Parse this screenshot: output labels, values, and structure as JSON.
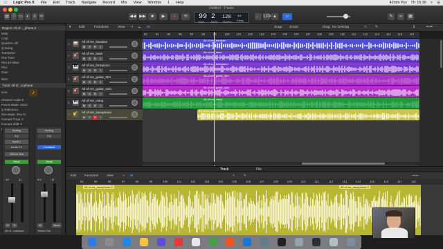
{
  "menubar": {
    "apple": "",
    "app": "Logic Pro X",
    "items": [
      "File",
      "Edit",
      "Track",
      "Navigate",
      "Record",
      "Mix",
      "View",
      "Window",
      "1",
      "Help"
    ],
    "status": "42min Рус",
    "clock": "Пт 15:36"
  },
  "window": {
    "title": "Untitled - Tracks"
  },
  "lcd": {
    "bar": "99",
    "beat": "2",
    "bar_label": "BAR",
    "beat_label": "BEAT",
    "tempo": "120",
    "tempo_label": "TEMPO",
    "signature": "4/4",
    "key": "Cmaj"
  },
  "inspector": {
    "region_header": "Region: All of..._phone.2",
    "region_params": [
      "Mute:",
      "Loop:",
      "Quantize: off",
      "Q-Swing:",
      "Transpose:",
      "Fine Tune:",
      "Flex & Follow:",
      "Flex:",
      "Gain:"
    ],
    "more": "More",
    "track_header": "Track: All of...xophone",
    "track_params": [
      "Icon:",
      "Channel: Audio 6",
      "Freeze Mode: Sourc",
      "Q-Reference:",
      "Flex Mode: Flex Pi",
      "Formant Track: 0",
      "Formant Shift: 0",
      "Formants: Proce"
    ],
    "strip1_label": "All of...xophone",
    "strip2_label": "Stereo Out",
    "strip1_buttons": [
      "Setting",
      "EQ",
      "Input 1",
      "Audio FX",
      "Stereo Out",
      "Read"
    ],
    "strip2_buttons": [
      "Setting",
      "EQ",
      "Constant",
      "Read"
    ],
    "strip1_value": "-10",
    "strip1_value2": "-11",
    "strip2_value": "0.0",
    "strip2_value2": "-17",
    "bnce_label": "Bnce"
  },
  "tracks_toolbar": {
    "edit": "Edit",
    "functions": "Functions",
    "view": "View",
    "snap_label": "Snap:",
    "snap_value": "Smart",
    "drag_label": "Drag:",
    "drag_value": "No Overlap"
  },
  "ruler": [
    "93",
    "94",
    "95",
    "96",
    "97",
    "98",
    "99",
    "100",
    "101",
    "102",
    "103",
    "104",
    "105",
    "106",
    "107",
    "108",
    "109",
    "110",
    "111",
    "112",
    "113",
    "114",
    "115",
    "116"
  ],
  "tracks": [
    {
      "num": "1",
      "name": "All of me_baraban",
      "icon": "🥁"
    },
    {
      "num": "2",
      "name": "All of me_bass",
      "icon": "🎸"
    },
    {
      "num": "3",
      "name": "All of me_fortepiano",
      "icon": "🎹"
    },
    {
      "num": "4",
      "name": "All of me_guitar_ritm",
      "icon": "🎸"
    },
    {
      "num": "5",
      "name": "All of me_guitar_solo",
      "icon": "🎸"
    },
    {
      "num": "6",
      "name": "All of me_vstup",
      "icon": "🎹"
    },
    {
      "num": "7",
      "name": "All of me_saxophone",
      "icon": "🎷"
    }
  ],
  "track_buttons": {
    "mute": "M",
    "solo": "S",
    "rec": "R",
    "input": "I"
  },
  "regions": [
    {
      "label": "All of me_baraban",
      "color": "#4f4fd6"
    },
    {
      "label": "All of me_bass",
      "color": "#6b3fc6"
    },
    {
      "label": "All of me_fortepiano",
      "color": "#7e3ad0"
    },
    {
      "label": "All of me_guitar_ritm",
      "color": "#a532c6"
    },
    {
      "label": "All of me_guitar_solo",
      "color": "#b02fc8"
    },
    {
      "label": "All of me_vstup",
      "color": "#1f9a3c"
    },
    {
      "label": "All of me_saxophone.2",
      "color": "#c9c64a"
    }
  ],
  "bottom_tabs": {
    "track": "Track",
    "file": "File"
  },
  "editor_toolbar": {
    "edit": "Edit",
    "functions": "Functions",
    "view": "View"
  },
  "editor_ruler": [
    "94",
    "95",
    "96",
    "97",
    "98",
    "99",
    "100",
    "101",
    "102",
    "103",
    "104",
    "105",
    "106",
    "107",
    "108",
    "109",
    "110",
    "111",
    "112",
    "113",
    "114",
    "115",
    "116",
    "117",
    "118"
  ],
  "editor_region_labels": [
    "All of me_saxophone.2",
    "All of me_saxophone.2"
  ],
  "colors": {
    "accent": "#2d6ad8",
    "sax_region": "#c9c64a",
    "editor_bg": "#b9b634"
  }
}
